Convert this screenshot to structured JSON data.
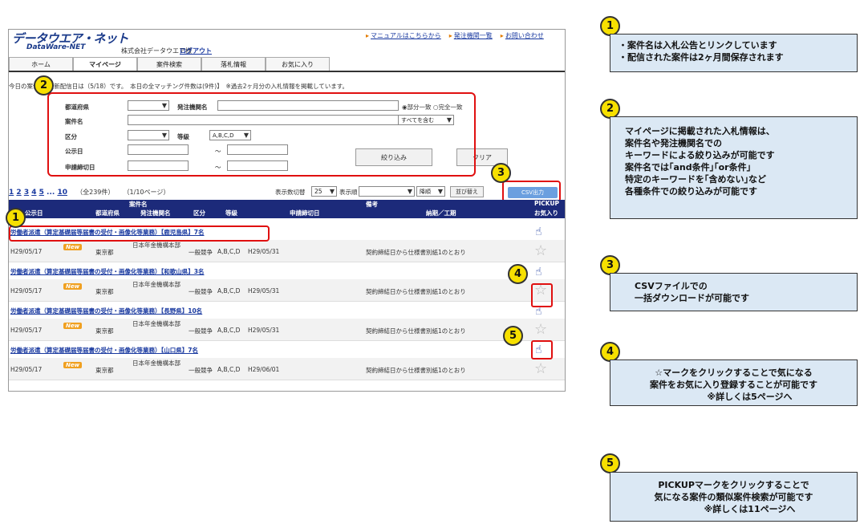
{
  "header": {
    "logo_text": "データウエア・ネット",
    "logo_sub": "DataWare-NET",
    "company": "株式会社データウエア様",
    "logout": "ログアウト",
    "top_links": [
      "マニュアルはこちらから",
      "発注機関一覧",
      "お問い合わせ"
    ]
  },
  "nav": {
    "tabs": [
      "ホーム",
      "マイページ",
      "案件検索",
      "落札情報",
      "お気に入り"
    ],
    "active": "マイページ"
  },
  "notice": "今日の案件　【最新配信日は（5/18）です。　本日の全マッチング件数は(9件)】　※過去2ヶ月分の入札情報を掲載しています。",
  "filter": {
    "prefecture_label": "都道府県",
    "orderer_label": "発注機関名",
    "match_options": "◉部分一致 ○完全一致",
    "case_name_label": "案件名",
    "contain_option": "すべてを含む",
    "category_label": "区分",
    "grade_label": "等級",
    "grade_value": "A,B,C,D",
    "pubdate_label": "公示日",
    "deadline_label": "申請締切日",
    "tilde": "～",
    "narrow_button": "絞り込み",
    "clear_button": "クリア"
  },
  "pager": {
    "pages": [
      "1",
      "2",
      "3",
      "4",
      "5",
      "...",
      "10"
    ],
    "total": "（全239件）",
    "page_info": "（1/10ページ）",
    "display_count_label": "表示数切替",
    "display_count_value": "25",
    "order_label": "表示順",
    "order_dir": "降順",
    "sort_button": "並び替え",
    "csv_button": "CSV出力"
  },
  "table": {
    "header1": {
      "case_name": "案件名",
      "remarks": "備考",
      "pickup": "PICKUP"
    },
    "header2": {
      "pubdate": "公示日",
      "pref": "都道府県",
      "orderer": "発注機関名",
      "category": "区分",
      "grade": "等級",
      "deadline": "申請締切日",
      "delivery": "納期／工期",
      "favorite": "お気入り"
    },
    "rows": [
      {
        "title": "労働者派遣（算定基礎届等届書の受付・画像化等業務）【鹿児島県】7名",
        "date": "H29/05/17",
        "new": "New",
        "pref": "東京都",
        "orderer": "日本年金機構本部",
        "category": "一般競争",
        "grade": "A,B,C,D",
        "deadline": "H29/05/31",
        "delivery": "契約締結日から仕様書別紙1のとおり"
      },
      {
        "title": "労働者派遣（算定基礎届等届書の受付・画像化等業務）【和歌山県】3名",
        "date": "H29/05/17",
        "new": "New",
        "pref": "東京都",
        "orderer": "日本年金機構本部",
        "category": "一般競争",
        "grade": "A,B,C,D",
        "deadline": "H29/05/31",
        "delivery": "契約締結日から仕様書別紙1のとおり"
      },
      {
        "title": "労働者派遣（算定基礎届等届書の受付・画像化等業務）【長野県】10名",
        "date": "H29/05/17",
        "new": "New",
        "pref": "東京都",
        "orderer": "日本年金機構本部",
        "category": "一般競争",
        "grade": "A,B,C,D",
        "deadline": "H29/05/31",
        "delivery": "契約締結日から仕様書別紙1のとおり"
      },
      {
        "title": "労働者派遣（算定基礎届等届書の受付・画像化等業務）【山口県】7名",
        "date": "H29/05/17",
        "new": "New",
        "pref": "東京都",
        "orderer": "日本年金機構本部",
        "category": "一般競争",
        "grade": "A,B,C,D",
        "deadline": "H29/06/01",
        "delivery": "契約締結日から仕様書別紙1のとおり"
      }
    ]
  },
  "badges": [
    "1",
    "2",
    "3",
    "4",
    "5"
  ],
  "callouts": [
    {
      "num": "1",
      "lines": [
        "・案件名は入札公告とリンクしています",
        "・配信された案件は2ヶ月間保存されます"
      ]
    },
    {
      "num": "2",
      "lines": [
        "マイページに掲載された入札情報は、",
        "案件名や発注機関名での",
        "キーワードによる絞り込みが可能です",
        "案件名では｢and条件｣｢or条件｣",
        "特定のキーワードを｢含めない｣など",
        "各種条件での絞り込みが可能です"
      ]
    },
    {
      "num": "3",
      "lines": [
        "CSVファイルでの",
        "一括ダウンロードが可能です"
      ]
    },
    {
      "num": "4",
      "lines": [
        "☆マークをクリックすることで気になる",
        "案件をお気に入り登録することが可能です",
        "※詳しくは5ページへ"
      ]
    },
    {
      "num": "5",
      "lines": [
        "PICKUPマークをクリックすることで",
        "気になる案件の類似案件検索が可能です",
        "※詳しくは11ページへ"
      ]
    }
  ]
}
